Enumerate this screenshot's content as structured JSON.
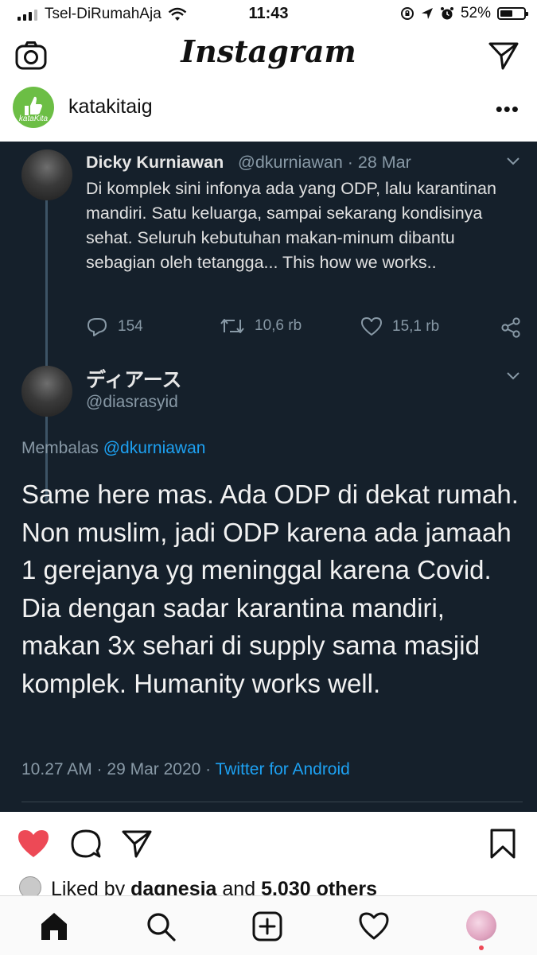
{
  "status_bar": {
    "carrier": "Tsel-DiRumahAja",
    "time": "11:43",
    "battery": "52%",
    "battery_level": 0.52
  },
  "header": {
    "logo": "Instagram",
    "left_icon": "camera-icon",
    "right_icon": "direct-send-icon"
  },
  "post": {
    "author": "katakitaig",
    "avatar_label": "kataKita",
    "menu_icon": "more-icon",
    "more": "•••"
  },
  "tweet1": {
    "name": "Dicky Kurniawan",
    "handle": "@dkurniawan · 28 Mar",
    "text": "Di komplek sini infonya ada yang ODP, lalu karantinan mandiri. Satu keluarga, sampai sekarang kondisinya sehat. Seluruh kebutuhan makan-minum dibantu sebagian oleh tetangga... This how we works..",
    "replies": "154",
    "retweets": "10,6 rb",
    "likes": "15,1 rb"
  },
  "tweet2": {
    "name": "ディアース",
    "handle": "@diasrasyid",
    "replying_prefix": "Membalas",
    "replying_to": "@dkurniawan",
    "text": "Same here mas. Ada ODP di dekat rumah. Non muslim, jadi ODP karena ada jamaah 1 gerejanya yg meninggal karena Covid. Dia dengan sadar karantina mandiri, makan 3x sehari di supply sama masjid komplek. Humanity works well.",
    "timestamp": "10.27 AM · 29 Mar 2020 · ",
    "source": "Twitter for Android"
  },
  "post_actions": {
    "liked": true,
    "liked_prefix": "Liked by",
    "liked_user": "dagnesia",
    "liked_and": "and",
    "liked_others": "5.030 others"
  },
  "bottom_nav": [
    "home-icon",
    "search-icon",
    "new-post-icon",
    "activity-heart-icon",
    "profile-avatar"
  ],
  "colors": {
    "tweet_bg": "#15202b",
    "twitter_blue": "#1da1f2",
    "like_red": "#ed4956",
    "kk_green": "#6cbe45"
  }
}
